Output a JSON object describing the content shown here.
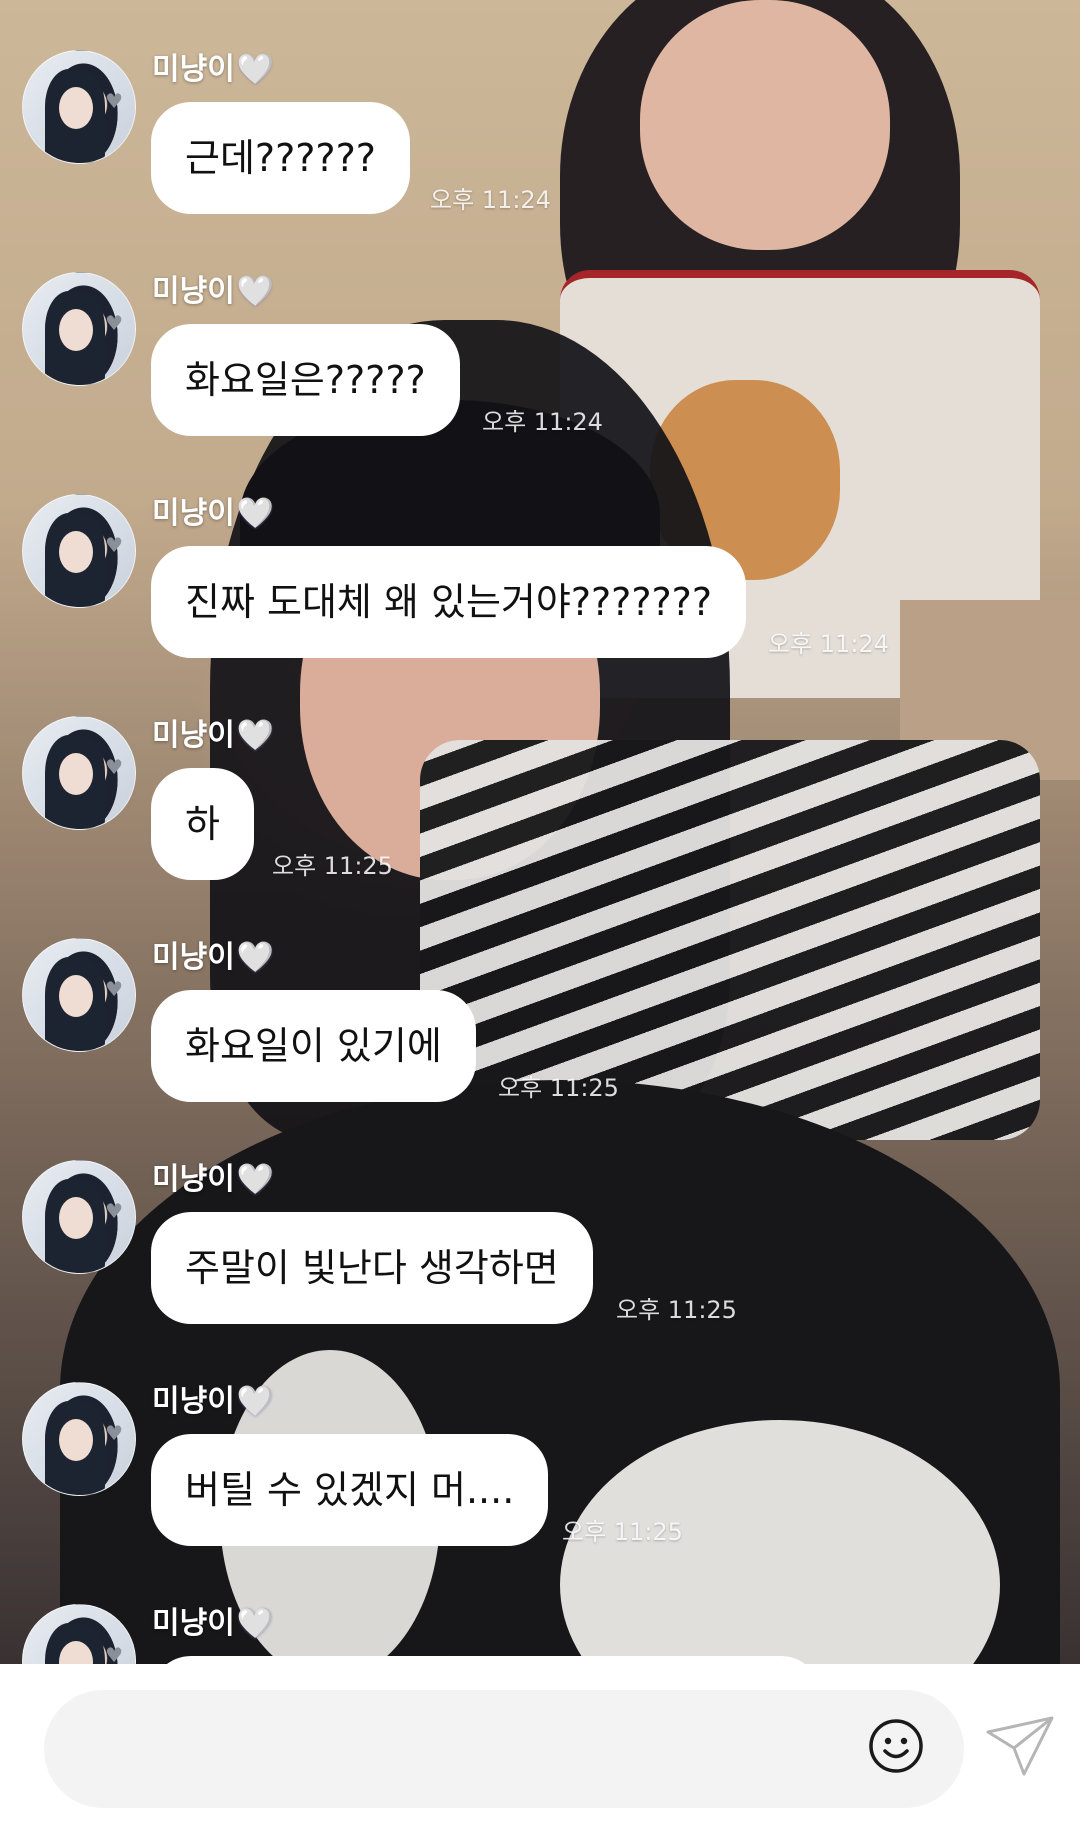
{
  "messages": [
    {
      "sender": "미냥이",
      "text": "근데??????",
      "time": "오후 11:24"
    },
    {
      "sender": "미냥이",
      "text": "화요일은?????",
      "time": "오후 11:24"
    },
    {
      "sender": "미냥이",
      "text": "진짜 도대체 왜 있는거야???????",
      "time": "오후 11:24"
    },
    {
      "sender": "미냥이",
      "text": "하",
      "time": "오후 11:25"
    },
    {
      "sender": "미냥이",
      "text": "화요일이 있기에",
      "time": "오후 11:25"
    },
    {
      "sender": "미냥이",
      "text": "주말이 빛난다 생각하면",
      "time": "오후 11:25"
    },
    {
      "sender": "미냥이",
      "text": "버틸 수 있겠지 머....",
      "time": "오후 11:25"
    },
    {
      "sender": "미냥이",
      "text": "",
      "time": ""
    }
  ],
  "heart": "🤍",
  "input": {
    "value": "",
    "placeholder": ""
  },
  "icons": {
    "emoji": "smiley-icon",
    "send": "paper-plane-icon"
  }
}
